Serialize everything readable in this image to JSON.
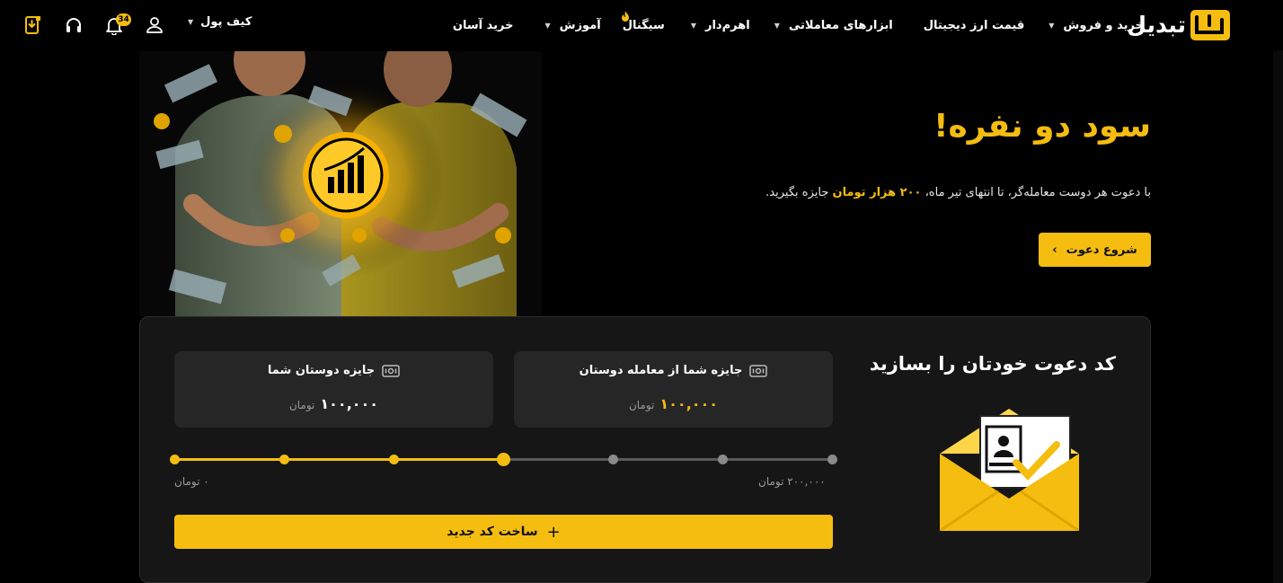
{
  "header": {
    "logo_text": "تبدیل",
    "nav": [
      {
        "label": "خرید و فروش",
        "caret": true,
        "hot": false
      },
      {
        "label": "قیمت ارز دیجیتال",
        "caret": false,
        "hot": false
      },
      {
        "label": "ابزارهای معاملاتی",
        "caret": true,
        "hot": false
      },
      {
        "label": "اهرم‌دار",
        "caret": true,
        "hot": false
      },
      {
        "label": "سیگنال",
        "caret": false,
        "hot": true
      },
      {
        "label": "آموزش",
        "caret": true,
        "hot": false
      },
      {
        "label": "خرید آسان",
        "caret": false,
        "hot": false
      }
    ],
    "wallet_label": "کیف پول",
    "notification_count": "34",
    "icons": [
      "download-app-icon",
      "headset-icon",
      "bell-icon",
      "user-icon"
    ]
  },
  "hero": {
    "title": "سود دو نفره!",
    "desc_before": "با دعوت هر دوست معامله‌گر، تا انتهای تیر ماه،",
    "desc_highlight": "۲۰۰ هزار تومان",
    "desc_after": "جایزه بگیرید.",
    "button_label": "شروع دعوت"
  },
  "invite_card": {
    "title": "کد دعوت خودتان را بسازید",
    "stats": [
      {
        "label": "جایزه شما از معامله دوستان",
        "value": "۱۰۰,۰۰۰",
        "unit": "تومان"
      },
      {
        "label": "جایزه دوستان شما",
        "value": "۱۰۰,۰۰۰",
        "unit": "تومان"
      }
    ],
    "slider": {
      "steps": 7,
      "active_index": 3,
      "value_fraction": 0.5
    },
    "range_min": "۰ تومان",
    "range_max": "۲۰۰,۰۰۰ تومان",
    "create_label": "ساخت کد جدید"
  },
  "colors": {
    "accent": "#f5bd10",
    "background": "#000000",
    "card": "#161616",
    "tile": "#262626"
  }
}
